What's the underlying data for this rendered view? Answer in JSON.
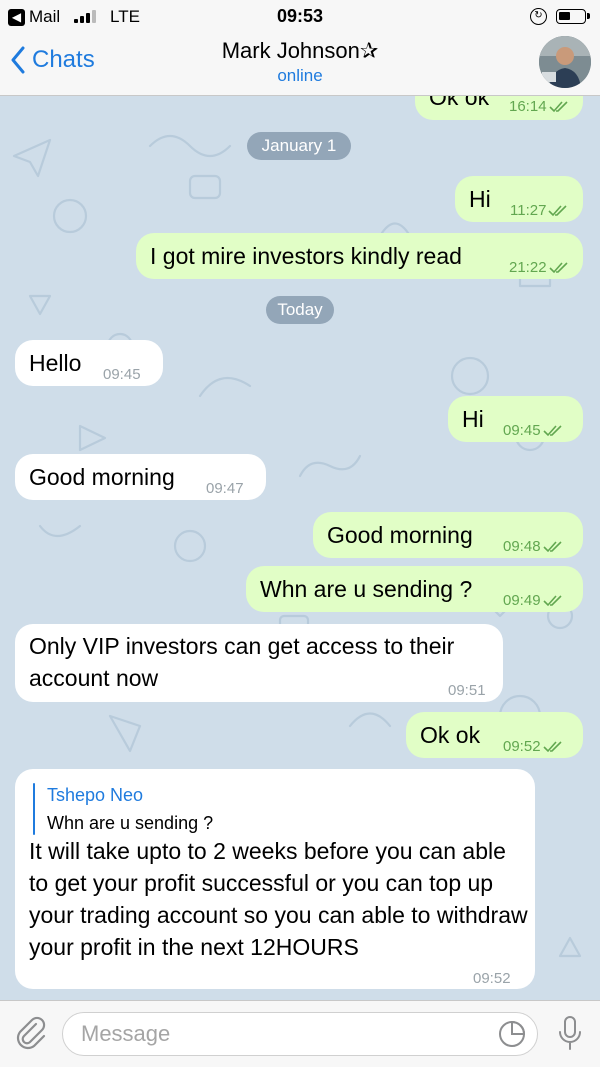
{
  "status_bar": {
    "back_app": "Mail",
    "network": "LTE",
    "time": "09:53"
  },
  "header": {
    "back_label": "Chats",
    "contact_name": "Mark Johnson✰",
    "contact_status": "online"
  },
  "messages": {
    "m0": {
      "text": "Ok ok",
      "time": "16:14"
    },
    "date1": "January 1",
    "m1": {
      "text": "Hi",
      "time": "11:27"
    },
    "m2": {
      "text": "I got mire investors kindly read",
      "time": "21:22"
    },
    "date2": "Today",
    "m3": {
      "text": "Hello",
      "time": "09:45"
    },
    "m4": {
      "text": "Hi",
      "time": "09:45"
    },
    "m5": {
      "text": "Good morning",
      "time": "09:47"
    },
    "m6": {
      "text": "Good morning",
      "time": "09:48"
    },
    "m7": {
      "text": "Whn are u sending ?",
      "time": "09:49"
    },
    "m8": {
      "text": "Only VIP investors can get access to their account now",
      "time": "09:51"
    },
    "m9": {
      "text": "Ok ok",
      "time": "09:52"
    },
    "m10": {
      "reply_name": "Tshepo Neo",
      "reply_text": "Whn are u sending ?",
      "text": "It will take upto to 2 weeks before you can able to get your profit successful or you can top up your trading account so you can able to withdraw your profit in the next 12HOURS",
      "time": "09:52"
    }
  },
  "composer": {
    "placeholder": "Message"
  },
  "colors": {
    "accent": "#1f7bde",
    "outgoing_bubble": "#e1fec6",
    "incoming_bubble": "#ffffff",
    "wallpaper": "#cfdde9",
    "read_check": "#62a750"
  },
  "icons": [
    "back-chevron-icon",
    "attach-icon",
    "sticker-icon",
    "microphone-icon",
    "double-check-icon",
    "lock-rotation-icon",
    "battery-icon",
    "signal-icon"
  ]
}
